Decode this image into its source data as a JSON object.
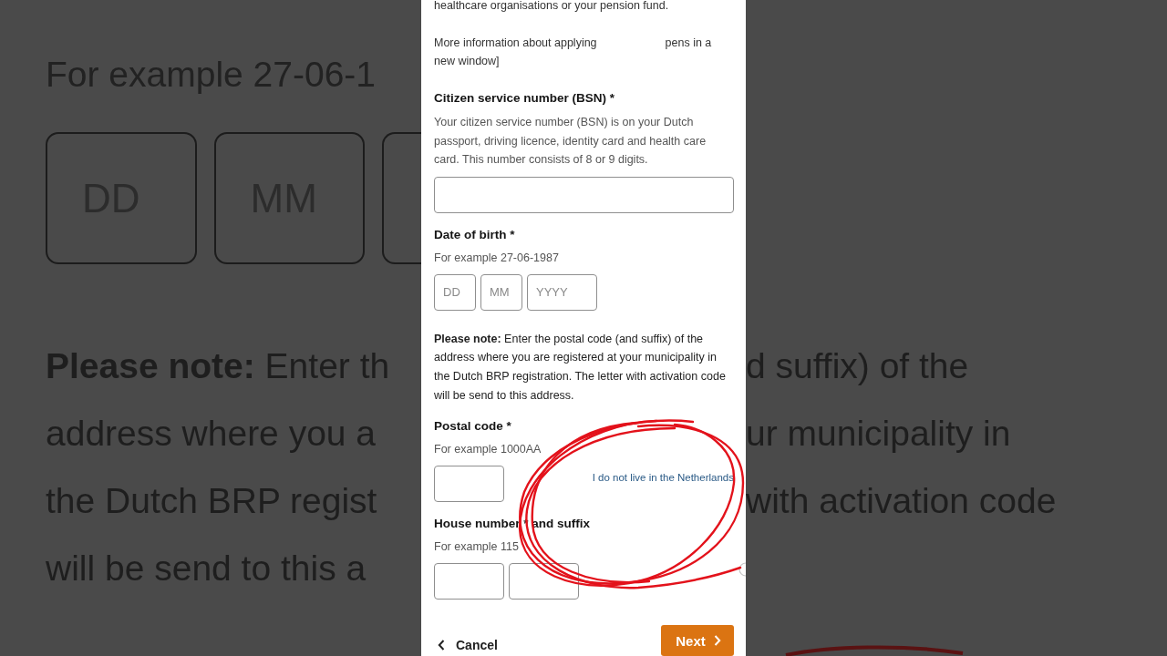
{
  "backdrop": {
    "hint": "For example 27-06-1",
    "date_fields": [
      "DD",
      "MM"
    ],
    "left_lines": [
      "**Please note:** Enter th",
      "address where you a",
      "the Dutch BRP regist",
      "will be send to this a"
    ],
    "right_lines": [
      "d suffix) of the",
      "ur municipality in",
      "with activation code"
    ]
  },
  "form": {
    "intro": "healthcare organisations or your pension fund.",
    "info": [
      "More information about applying",
      "pens in a",
      "new window]"
    ],
    "fields": [
      {
        "kind": "text",
        "label": "Citizen service number (BSN) *",
        "hint": "Your citizen service number (BSN) is on your Dutch passport, driving licence, identity card and health care card. This number consists of 8 or 9 digits.",
        "inputs": [
          {
            "kind": "wide"
          }
        ]
      },
      {
        "kind": "date",
        "label": "Date of birth *",
        "hint": "For example 27-06-1987",
        "inputs": [
          {
            "kind": "narrow",
            "placeholder": "DD"
          },
          {
            "kind": "narrow",
            "placeholder": "MM"
          },
          {
            "kind": "medium",
            "placeholder": "YYYY"
          }
        ]
      },
      {
        "kind": "note",
        "text": "**Please note:** Enter the postal code (and suffix) of the address where you are registered at your municipality in the Dutch BRP registration. The letter with activation code will be send to this address."
      },
      {
        "kind": "postal",
        "label": "Postal code *",
        "hint": "For example 1000AA",
        "inputs": [
          {
            "kind": "medium"
          }
        ],
        "link": "I do not live in the Netherlands"
      },
      {
        "kind": "house",
        "label": "House number * and suffix",
        "hint": "For example 115",
        "inputs": [
          {
            "kind": "medium"
          },
          {
            "kind": "medium"
          }
        ]
      }
    ],
    "actions": {
      "cancel": "Cancel",
      "next": "Next"
    }
  }
}
